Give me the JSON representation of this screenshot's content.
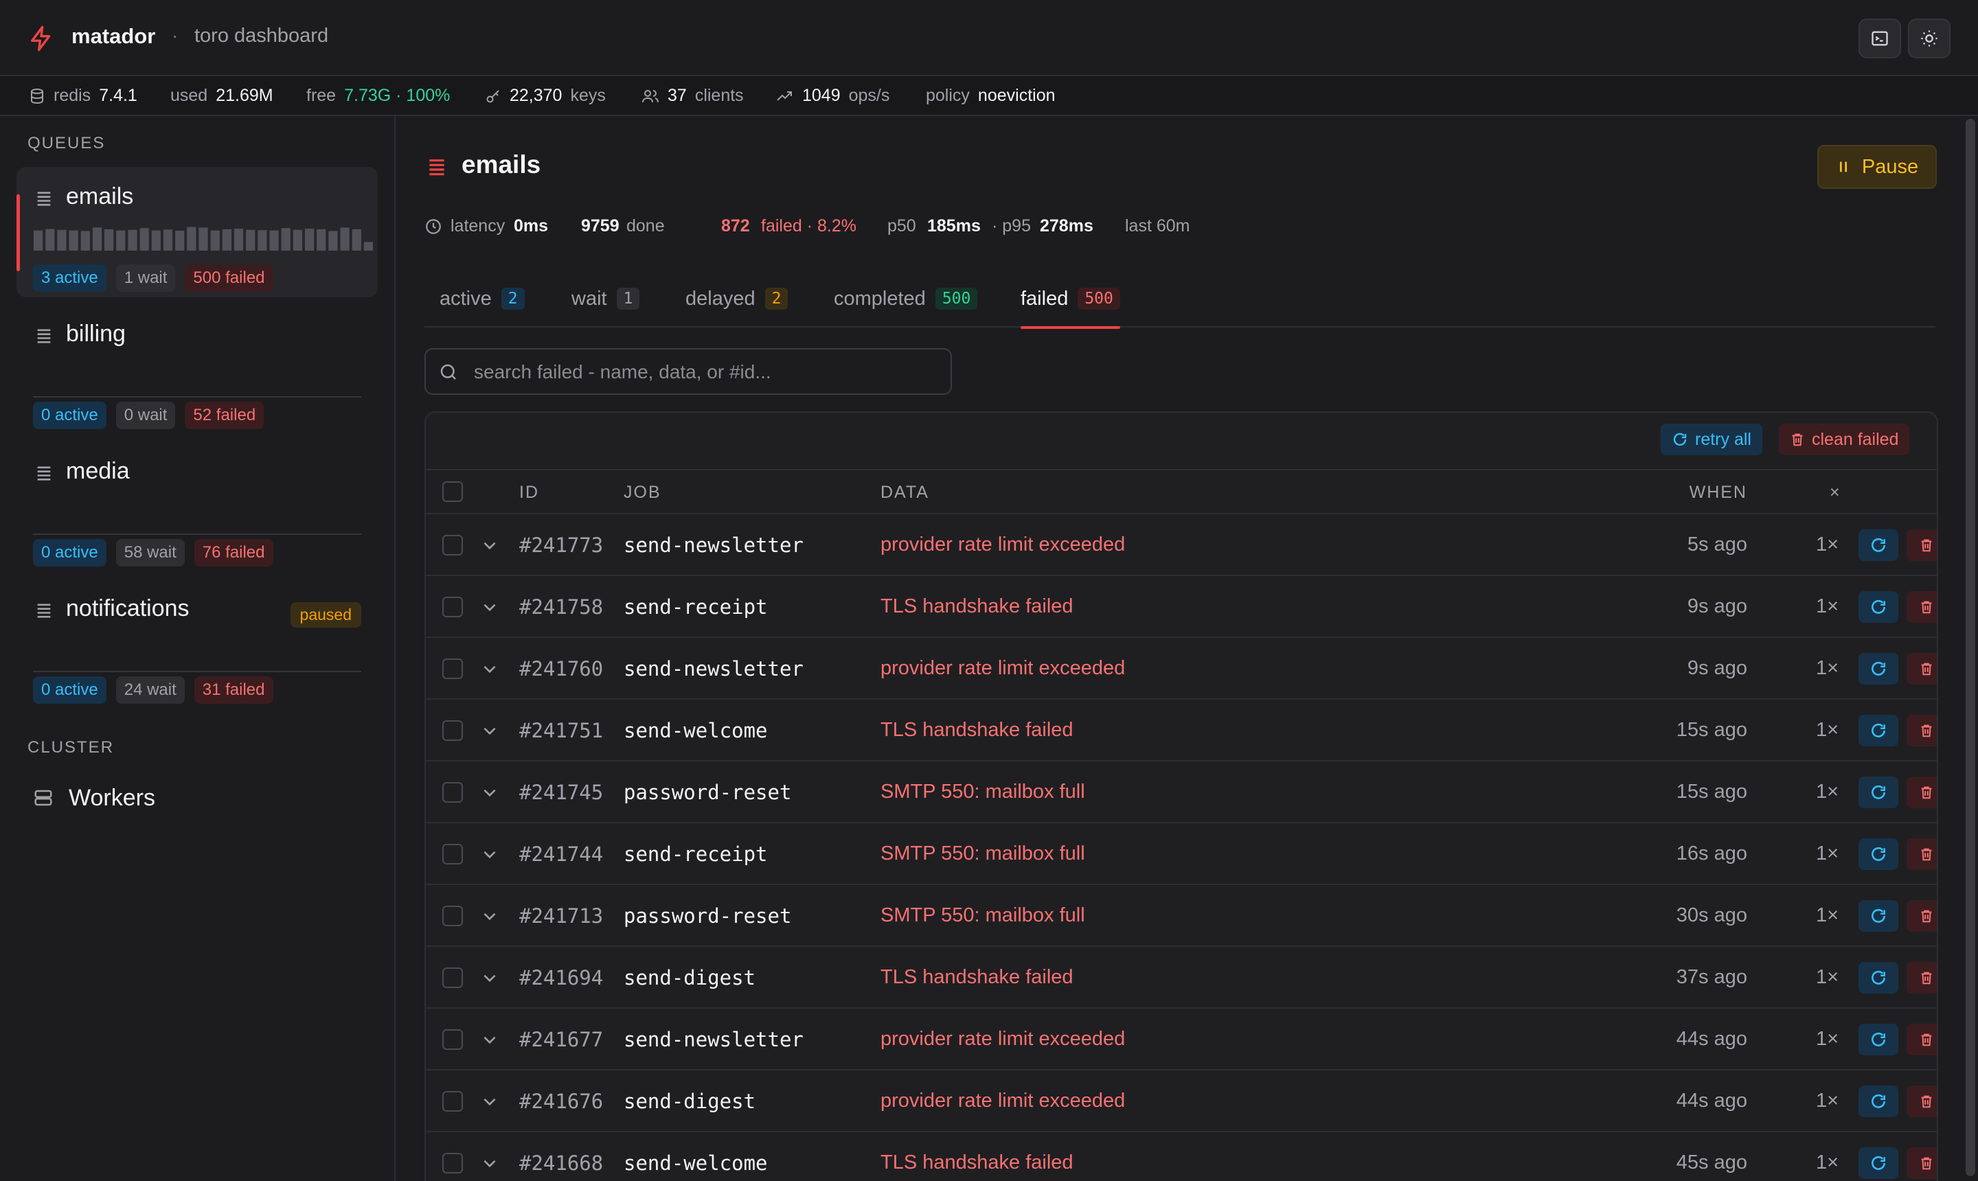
{
  "brand": {
    "name": "matador",
    "separator": "·",
    "subtitle": "toro dashboard"
  },
  "header_buttons": {
    "terminal_icon": "terminal-icon",
    "theme_icon": "sun-icon"
  },
  "stats": {
    "redis_label": "redis",
    "redis_version": "7.4.1",
    "used_label": "used",
    "used_value": "21.69M",
    "free_label": "free",
    "free_value": "7.73G · 100%",
    "keys_value": "22,370",
    "keys_label": "keys",
    "clients_value": "37",
    "clients_label": "clients",
    "ops_value": "1049",
    "ops_label": "ops/s",
    "policy_label": "policy",
    "policy_value": "noeviction"
  },
  "sidebar": {
    "queues_label": "QUEUES",
    "queues": [
      {
        "name": "emails",
        "active": "3 active",
        "wait": "1 wait",
        "failed": "500 failed",
        "selected": true,
        "spark": [
          0.7,
          0.75,
          0.72,
          0.7,
          0.68,
          0.8,
          0.74,
          0.7,
          0.72,
          0.78,
          0.7,
          0.73,
          0.69,
          0.82,
          0.8,
          0.7,
          0.74,
          0.76,
          0.72,
          0.71,
          0.7,
          0.78,
          0.72,
          0.76,
          0.74,
          0.68,
          0.8,
          0.74,
          0.3
        ]
      },
      {
        "name": "billing",
        "active": "0 active",
        "wait": "0 wait",
        "failed": "52 failed"
      },
      {
        "name": "media",
        "active": "0 active",
        "wait": "58 wait",
        "failed": "76 failed"
      },
      {
        "name": "notifications",
        "status": "paused",
        "active": "0 active",
        "wait": "24 wait",
        "failed": "31 failed"
      }
    ],
    "cluster_label": "CLUSTER",
    "workers_label": "Workers"
  },
  "main": {
    "queue_title": "emails",
    "pause_label": "Pause",
    "meta": {
      "latency_label": "latency",
      "latency_value": "0ms",
      "done_value": "9759",
      "done_label": "done",
      "failed_value": "872",
      "failed_label": "failed · 8.2%",
      "p50_label": "p50",
      "p50_value": "185ms",
      "p95_label": "· p95",
      "p95_value": "278ms",
      "window": "last 60m"
    },
    "tabs": [
      {
        "label": "active",
        "count": "2"
      },
      {
        "label": "wait",
        "count": "1"
      },
      {
        "label": "delayed",
        "count": "2"
      },
      {
        "label": "completed",
        "count": "500"
      },
      {
        "label": "failed",
        "count": "500"
      }
    ],
    "search": {
      "placeholder": "search failed - name, data, or #id..."
    },
    "toolbar": {
      "retry_all": "retry all",
      "clean_failed": "clean failed"
    },
    "columns": {
      "id": "ID",
      "job": "JOB",
      "data": "DATA",
      "when": "WHEN",
      "attempts": "×"
    },
    "rows": [
      {
        "id": "#241773",
        "job": "send-newsletter",
        "data": "provider rate limit exceeded",
        "when": "5s ago",
        "attempts": "1×"
      },
      {
        "id": "#241758",
        "job": "send-receipt",
        "data": "TLS handshake failed",
        "when": "9s ago",
        "attempts": "1×"
      },
      {
        "id": "#241760",
        "job": "send-newsletter",
        "data": "provider rate limit exceeded",
        "when": "9s ago",
        "attempts": "1×"
      },
      {
        "id": "#241751",
        "job": "send-welcome",
        "data": "TLS handshake failed",
        "when": "15s ago",
        "attempts": "1×"
      },
      {
        "id": "#241745",
        "job": "password-reset",
        "data": "SMTP 550: mailbox full",
        "when": "15s ago",
        "attempts": "1×"
      },
      {
        "id": "#241744",
        "job": "send-receipt",
        "data": "SMTP 550: mailbox full",
        "when": "16s ago",
        "attempts": "1×"
      },
      {
        "id": "#241713",
        "job": "password-reset",
        "data": "SMTP 550: mailbox full",
        "when": "30s ago",
        "attempts": "1×"
      },
      {
        "id": "#241694",
        "job": "send-digest",
        "data": "TLS handshake failed",
        "when": "37s ago",
        "attempts": "1×"
      },
      {
        "id": "#241677",
        "job": "send-newsletter",
        "data": "provider rate limit exceeded",
        "when": "44s ago",
        "attempts": "1×"
      },
      {
        "id": "#241676",
        "job": "send-digest",
        "data": "provider rate limit exceeded",
        "when": "44s ago",
        "attempts": "1×"
      },
      {
        "id": "#241668",
        "job": "send-welcome",
        "data": "TLS handshake failed",
        "when": "45s ago",
        "attempts": "1×"
      }
    ]
  },
  "colors": {
    "accent": "#ef4444",
    "info": "#38bdf8",
    "success": "#34d399",
    "warning": "#f59e0b",
    "danger": "#f87171"
  }
}
